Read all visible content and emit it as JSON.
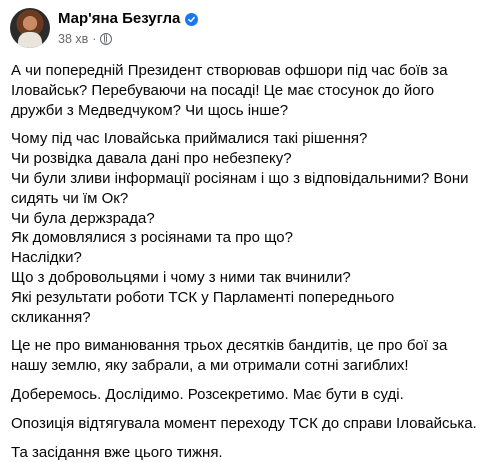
{
  "post": {
    "author_name": "Мар'яна Безугла",
    "time": "38 хв",
    "dot": "·",
    "paragraphs": [
      "А чи попередній Президент створював офшори під час боїв за\nІловайськ? Перебуваючи на посаді! Це має стосунок до його\nдружби з Медведчуком? Чи щось інше?",
      "Чому під час Іловайська приймалися такі рішення?\nЧи розвідка давала дані про небезпеку?\nЧи були зливи інформації росіянам і що з відповідальними? Вони\nсидять чи їм Ок?\nЧи була держзрада?\nЯк домовлялися з росіянами та про що?\nНаслідки?\nЩо з добровольцями і чому з ними так вчинили?\nЯкі результати роботи ТСК у Парламенті попереднього скликання?",
      "Це не про виманювання трьох десятків бандитів, це про бої за\nнашу землю, яку забрали, а ми отримали сотні загиблих!",
      "Доберемось. Дослідимо. Розсекретимо. Має бути в суді.",
      "Опозиція відтягувала момент переходу ТСК до справи Іловайська.",
      "Та засідання вже цього тижня."
    ]
  },
  "icons": {
    "verified": "verified-badge-icon",
    "audience": "globe-icon"
  },
  "colors": {
    "verified_blue": "#1877f2",
    "secondary_text": "#65676b",
    "primary_text": "#050505"
  }
}
